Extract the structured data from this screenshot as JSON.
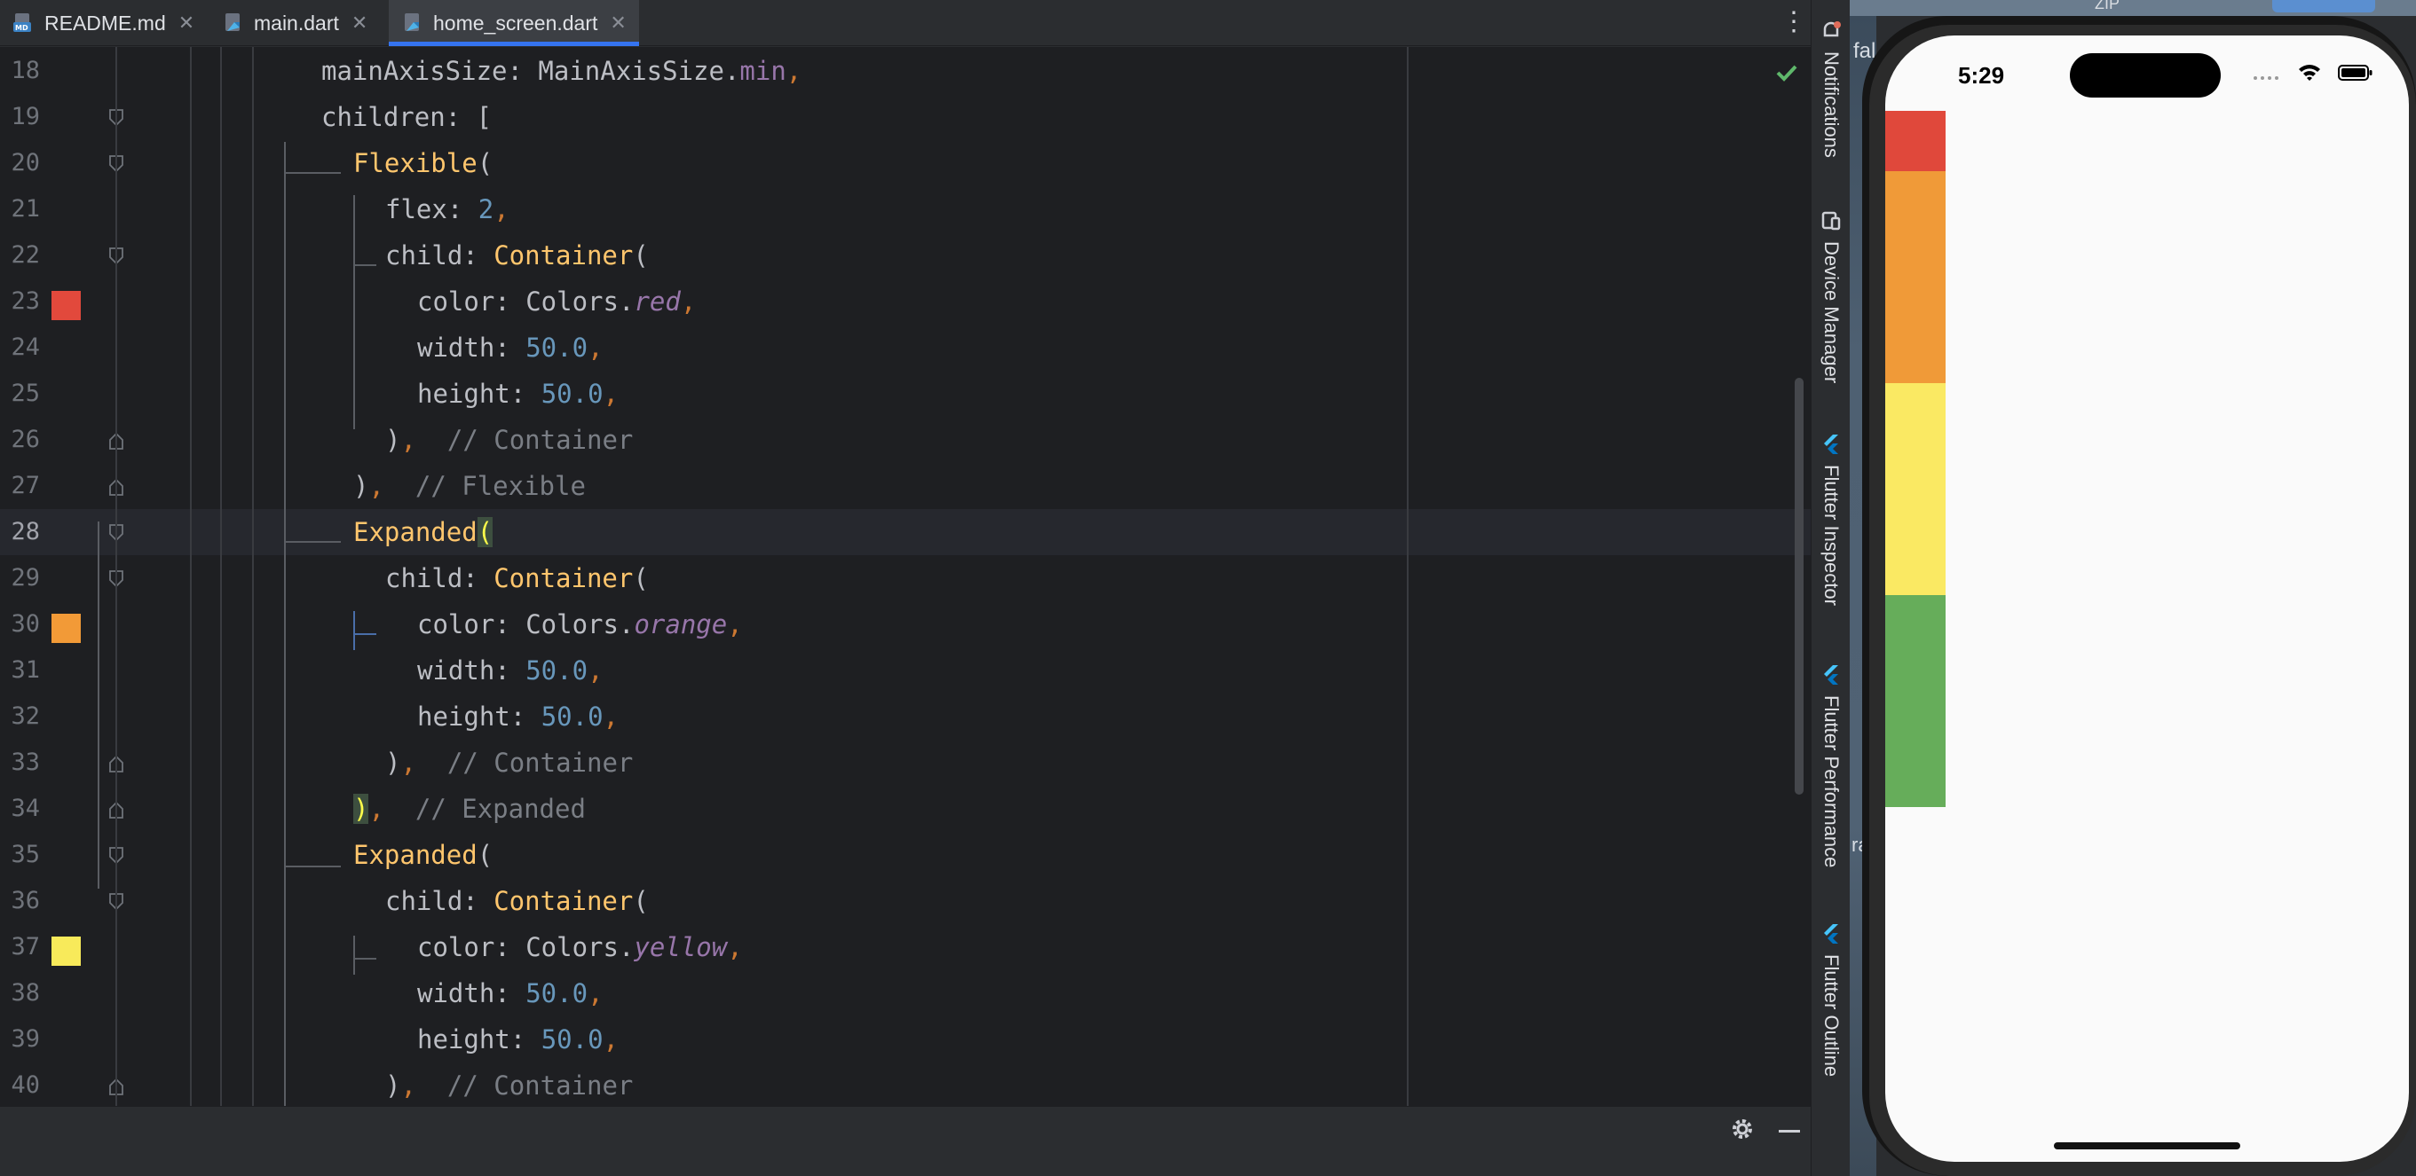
{
  "tabs": [
    {
      "label": "README.md",
      "icon": "markdown-file-icon",
      "active": false
    },
    {
      "label": "main.dart",
      "icon": "dart-file-icon",
      "active": false
    },
    {
      "label": "home_screen.dart",
      "icon": "dart-file-icon",
      "active": true
    }
  ],
  "editor": {
    "lines": [
      {
        "n": "18",
        "tokens": [
          [
            "id",
            "mainAxisSize: MainAxisSize."
          ],
          [
            "field",
            "min"
          ],
          [
            "punct",
            ","
          ]
        ]
      },
      {
        "n": "19",
        "tokens": [
          [
            "id",
            "children: ["
          ]
        ]
      },
      {
        "n": "20",
        "tokens": [
          [
            "cls",
            "Flexible"
          ],
          [
            "id",
            "("
          ]
        ]
      },
      {
        "n": "21",
        "tokens": [
          [
            "id",
            "flex: "
          ],
          [
            "num",
            "2"
          ],
          [
            "punct",
            ","
          ]
        ]
      },
      {
        "n": "22",
        "tokens": [
          [
            "id",
            "child: "
          ],
          [
            "cls",
            "Container"
          ],
          [
            "id",
            "("
          ]
        ]
      },
      {
        "n": "23",
        "tokens": [
          [
            "id",
            "color: Colors."
          ],
          [
            "const",
            "red"
          ],
          [
            "punct",
            ","
          ]
        ]
      },
      {
        "n": "24",
        "tokens": [
          [
            "id",
            "width: "
          ],
          [
            "num",
            "50.0"
          ],
          [
            "punct",
            ","
          ]
        ]
      },
      {
        "n": "25",
        "tokens": [
          [
            "id",
            "height: "
          ],
          [
            "num",
            "50.0"
          ],
          [
            "punct",
            ","
          ]
        ]
      },
      {
        "n": "26",
        "tokens": [
          [
            "id",
            ")"
          ],
          [
            "punct",
            ","
          ],
          [
            "comm",
            "  // Container"
          ]
        ]
      },
      {
        "n": "27",
        "tokens": [
          [
            "id",
            ")"
          ],
          [
            "punct",
            ","
          ],
          [
            "comm",
            "  // Flexible"
          ]
        ]
      },
      {
        "n": "28",
        "tokens": [
          [
            "cls",
            "Expanded"
          ],
          [
            "brk",
            "("
          ]
        ]
      },
      {
        "n": "29",
        "tokens": [
          [
            "id",
            "child: "
          ],
          [
            "cls",
            "Container"
          ],
          [
            "id",
            "("
          ]
        ]
      },
      {
        "n": "30",
        "tokens": [
          [
            "id",
            "color: Colors."
          ],
          [
            "const",
            "orange"
          ],
          [
            "punct",
            ","
          ]
        ]
      },
      {
        "n": "31",
        "tokens": [
          [
            "id",
            "width: "
          ],
          [
            "num",
            "50.0"
          ],
          [
            "punct",
            ","
          ]
        ]
      },
      {
        "n": "32",
        "tokens": [
          [
            "id",
            "height: "
          ],
          [
            "num",
            "50.0"
          ],
          [
            "punct",
            ","
          ]
        ]
      },
      {
        "n": "33",
        "tokens": [
          [
            "id",
            ")"
          ],
          [
            "punct",
            ","
          ],
          [
            "comm",
            "  // Container"
          ]
        ]
      },
      {
        "n": "34",
        "tokens": [
          [
            "brk",
            ")"
          ],
          [
            "punct",
            ","
          ],
          [
            "comm",
            "  // Expanded"
          ]
        ]
      },
      {
        "n": "35",
        "tokens": [
          [
            "cls",
            "Expanded"
          ],
          [
            "id",
            "("
          ]
        ]
      },
      {
        "n": "36",
        "tokens": [
          [
            "id",
            "child: "
          ],
          [
            "cls",
            "Container"
          ],
          [
            "id",
            "("
          ]
        ]
      },
      {
        "n": "37",
        "tokens": [
          [
            "id",
            "color: Colors."
          ],
          [
            "const",
            "yellow"
          ],
          [
            "punct",
            ","
          ]
        ]
      },
      {
        "n": "38",
        "tokens": [
          [
            "id",
            "width: "
          ],
          [
            "num",
            "50.0"
          ],
          [
            "punct",
            ","
          ]
        ]
      },
      {
        "n": "39",
        "tokens": [
          [
            "id",
            "height: "
          ],
          [
            "num",
            "50.0"
          ],
          [
            "punct",
            ","
          ]
        ]
      },
      {
        "n": "40",
        "tokens": [
          [
            "id",
            ")"
          ],
          [
            "punct",
            ","
          ],
          [
            "comm",
            "  // Container"
          ]
        ]
      }
    ],
    "swatches": {
      "23": "#e2493c",
      "30": "#f29a37",
      "37": "#f8ea5a"
    }
  },
  "toolstrip": [
    {
      "label": "Notifications",
      "icon": "bell-icon"
    },
    {
      "label": "Device Manager",
      "icon": "device-icon"
    },
    {
      "label": "Flutter Inspector",
      "icon": "flutter-icon"
    },
    {
      "label": "Flutter Performance",
      "icon": "flutter-icon"
    },
    {
      "label": "Flutter Outline",
      "icon": "flutter-icon"
    }
  ],
  "desktop": {
    "zip": "ZIP",
    "fal": "fal",
    "ra": "ra"
  },
  "phone": {
    "time": "5:29",
    "bars": [
      {
        "color": "#e0483b",
        "flex": 2
      },
      {
        "color": "#f09a38",
        "flex": 7
      },
      {
        "color": "#fae963",
        "flex": 7
      },
      {
        "color": "#66ad5a",
        "flex": 7
      }
    ]
  }
}
